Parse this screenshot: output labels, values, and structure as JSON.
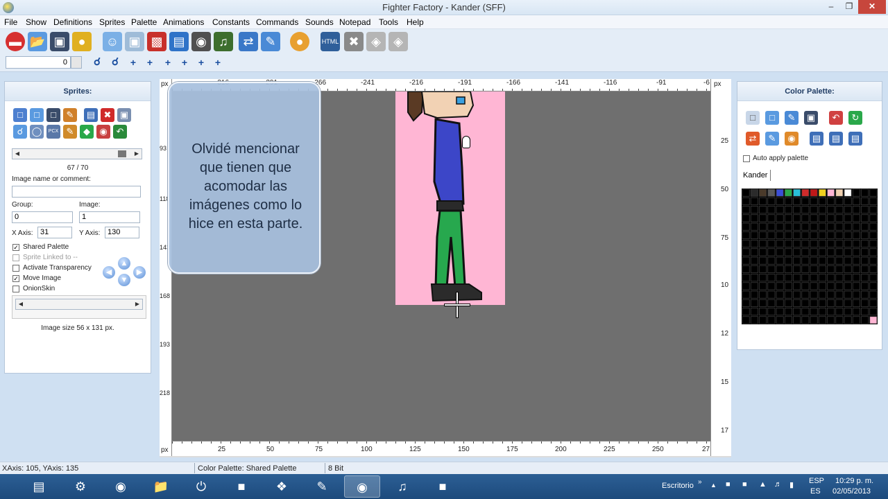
{
  "window": {
    "title": "Fighter Factory - Kander (SFF)",
    "min": "–",
    "max": "❐",
    "close": "✕"
  },
  "menu": [
    "File",
    "Show",
    "Definitions",
    "Sprites",
    "Palette",
    "Animations",
    "Constants",
    "Commands",
    "Sounds",
    "Notepad",
    "Tools",
    "Help"
  ],
  "toolbar": {
    "frame_value": "0",
    "icons": [
      "close-file-icon",
      "open-folder-icon",
      "save-icon",
      "lock-icon",
      "characters-icon",
      "image-icon",
      "film-icon",
      "window-icon",
      "joystick-icon",
      "sound-icon",
      "export-icon",
      "edit-icon",
      "palette-icon",
      "html-icon",
      "tools-icon",
      "gamepad-icon",
      "gamepad-settings-icon"
    ],
    "small_buttons": [
      "+",
      "+",
      "+",
      "+",
      "+",
      "+"
    ]
  },
  "sprites": {
    "title": "Sprites:",
    "counter": "67 / 70",
    "name_label": "Image name or comment:",
    "name_value": "",
    "group_label": "Group:",
    "group_value": "0",
    "image_label": "Image:",
    "image_value": "1",
    "xaxis_label": "X Axis:",
    "xaxis_value": "31",
    "yaxis_label": "Y Axis:",
    "yaxis_value": "130",
    "shared_palette": "Shared Palette",
    "sprite_linked": "Sprite Linked to --",
    "activate_transparency": "Activate Transparency",
    "move_image": "Move Image",
    "onion_skin": "OnionSkin",
    "image_size": "Image size 56 x 131 px."
  },
  "ruler": {
    "top_unit": "px",
    "top_labels": [
      "-316",
      "-291",
      "-266",
      "-241",
      "-216",
      "-191",
      "-166",
      "-141",
      "-116",
      "-91",
      "-6"
    ],
    "bottom_unit": "px",
    "bottom_labels": [
      "25",
      "50",
      "75",
      "100",
      "125",
      "150",
      "175",
      "200",
      "225",
      "250",
      "27"
    ],
    "left_labels": [
      "93",
      "118",
      "143",
      "168",
      "193",
      "218"
    ],
    "right_labels": [
      "25",
      "50",
      "75",
      "10",
      "12",
      "15",
      "17"
    ]
  },
  "note": {
    "line1": "Olvidé mencionar",
    "line2": "que tienen que",
    "line3": "acomodar las",
    "line4": "imágenes como lo",
    "line5": "hice en esta parte."
  },
  "palette": {
    "title": "Color Palette:",
    "auto_apply": "Auto apply palette",
    "tab": "Kander",
    "first_row_colors": [
      "#000000",
      "#2b2b2b",
      "#4a3a2a",
      "#5a5a5a",
      "#3b4fd8",
      "#2aa84a",
      "#28c0d8",
      "#d02b2b",
      "#c01818",
      "#f0d020",
      "#ffb6d4",
      "#f0d0b0",
      "#ffffff"
    ],
    "last_color": "#ffb6d4"
  },
  "status": {
    "coords": "XAxis: 105, YAxis: 135",
    "palette": "Color Palette: Shared Palette",
    "bits": "8 Bit"
  },
  "taskbar": {
    "desktop": "Escritorio",
    "lang_top": "ESP",
    "lang_bottom": "ES",
    "time": "10:29 p. m.",
    "date": "02/05/2013"
  }
}
